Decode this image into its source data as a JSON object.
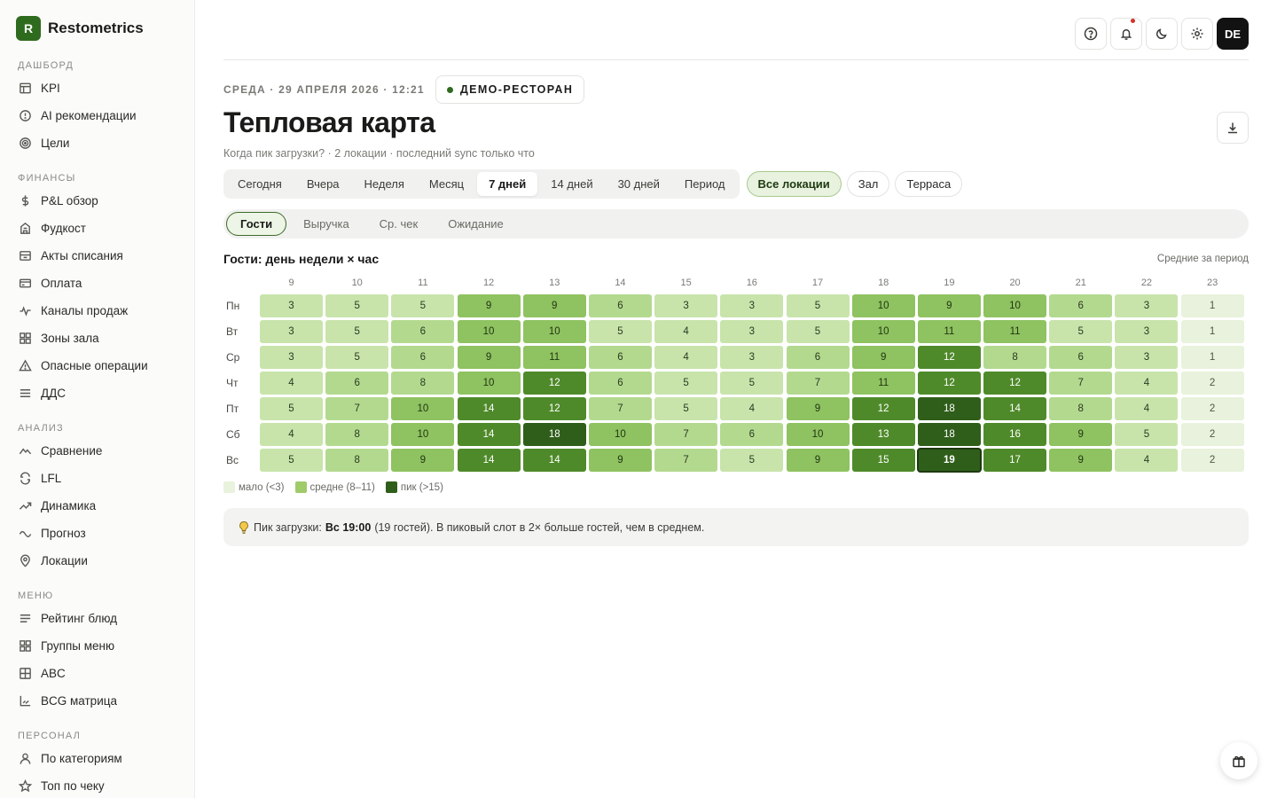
{
  "brand": {
    "logo_letter": "R",
    "name": "Restometrics"
  },
  "sidebar": {
    "sections": [
      {
        "title": "Дашборд",
        "items": [
          {
            "label": "KPI",
            "icon": "table-icon"
          },
          {
            "label": "AI рекомендации",
            "icon": "alert-circle-icon"
          },
          {
            "label": "Цели",
            "icon": "target-icon"
          }
        ]
      },
      {
        "title": "Финансы",
        "items": [
          {
            "label": "P&L обзор",
            "icon": "dollar-icon"
          },
          {
            "label": "Фудкост",
            "icon": "building-icon"
          },
          {
            "label": "Акты списания",
            "icon": "archive-icon"
          },
          {
            "label": "Оплата",
            "icon": "card-icon"
          },
          {
            "label": "Каналы продаж",
            "icon": "pulse-icon"
          },
          {
            "label": "Зоны зала",
            "icon": "grid-icon"
          },
          {
            "label": "Опасные операции",
            "icon": "warning-icon"
          },
          {
            "label": "ДДС",
            "icon": "list-icon"
          }
        ]
      },
      {
        "title": "Анализ",
        "items": [
          {
            "label": "Сравнение",
            "icon": "mountain-icon"
          },
          {
            "label": "LFL",
            "icon": "rotate-icon"
          },
          {
            "label": "Динамика",
            "icon": "trend-up-icon"
          },
          {
            "label": "Прогноз",
            "icon": "wave-icon"
          },
          {
            "label": "Локации",
            "icon": "pin-icon"
          }
        ]
      },
      {
        "title": "Меню",
        "items": [
          {
            "label": "Рейтинг блюд",
            "icon": "lines-icon"
          },
          {
            "label": "Группы меню",
            "icon": "grid-icon"
          },
          {
            "label": "ABC",
            "icon": "grid-plus-icon"
          },
          {
            "label": "BCG матрица",
            "icon": "axis-icon"
          }
        ]
      },
      {
        "title": "Персонал",
        "items": [
          {
            "label": "По категориям",
            "icon": "user-icon"
          },
          {
            "label": "Топ по чеку",
            "icon": "star-icon"
          }
        ]
      }
    ]
  },
  "header": {
    "date": "СРЕДА · 29 АПРЕЛЯ 2026 · 12:21",
    "restaurant": "ДЕМО-РЕСТОРАН",
    "title": "Тепловая карта",
    "subtitle": "Когда пик загрузки? · 2 локации · последний sync только что",
    "avatar": "DE"
  },
  "periods": [
    {
      "label": "Сегодня",
      "active": false
    },
    {
      "label": "Вчера",
      "active": false
    },
    {
      "label": "Неделя",
      "active": false
    },
    {
      "label": "Месяц",
      "active": false
    },
    {
      "label": "7 дней",
      "active": true
    },
    {
      "label": "14 дней",
      "active": false
    },
    {
      "label": "30 дней",
      "active": false
    },
    {
      "label": "Период",
      "active": false
    }
  ],
  "locations": [
    {
      "label": "Все локации",
      "active": true
    },
    {
      "label": "Зал",
      "active": false
    },
    {
      "label": "Терраса",
      "active": false
    }
  ],
  "metrics": [
    {
      "label": "Гости",
      "active": true
    },
    {
      "label": "Выручка",
      "active": false
    },
    {
      "label": "Ср. чек",
      "active": false
    },
    {
      "label": "Ожидание",
      "active": false
    }
  ],
  "heatmap": {
    "title": "Гости: день недели × час",
    "note": "Средние за период",
    "hours": [
      "9",
      "10",
      "11",
      "12",
      "13",
      "14",
      "15",
      "16",
      "17",
      "18",
      "19",
      "20",
      "21",
      "22",
      "23"
    ],
    "days": [
      "Пн",
      "Вт",
      "Ср",
      "Чт",
      "Пт",
      "Сб",
      "Вс"
    ],
    "values": [
      [
        3,
        5,
        5,
        9,
        9,
        6,
        3,
        3,
        5,
        10,
        9,
        10,
        6,
        3,
        1
      ],
      [
        3,
        5,
        6,
        10,
        10,
        5,
        4,
        3,
        5,
        10,
        11,
        11,
        5,
        3,
        1
      ],
      [
        3,
        5,
        6,
        9,
        11,
        6,
        4,
        3,
        6,
        9,
        12,
        8,
        6,
        3,
        1
      ],
      [
        4,
        6,
        8,
        10,
        12,
        6,
        5,
        5,
        7,
        11,
        12,
        12,
        7,
        4,
        2
      ],
      [
        5,
        7,
        10,
        14,
        12,
        7,
        5,
        4,
        9,
        12,
        18,
        14,
        8,
        4,
        2
      ],
      [
        4,
        8,
        10,
        14,
        18,
        10,
        7,
        6,
        10,
        13,
        18,
        16,
        9,
        5,
        2
      ],
      [
        5,
        8,
        9,
        14,
        14,
        9,
        7,
        5,
        9,
        15,
        19,
        17,
        9,
        4,
        2
      ]
    ],
    "peak": {
      "day": 6,
      "hour": 10
    },
    "legend": [
      {
        "label": "мало (<3)",
        "color": "#e8f2dc"
      },
      {
        "label": "средне (8–11)",
        "color": "#9fcb6a"
      },
      {
        "label": "пик (>15)",
        "color": "#2f5e1a"
      }
    ]
  },
  "insight": {
    "prefix": "Пик загрузки:",
    "highlight": "Вс 19:00",
    "suffix": "(19 гостей). В пиковый слот в 2× больше гостей, чем в среднем."
  }
}
